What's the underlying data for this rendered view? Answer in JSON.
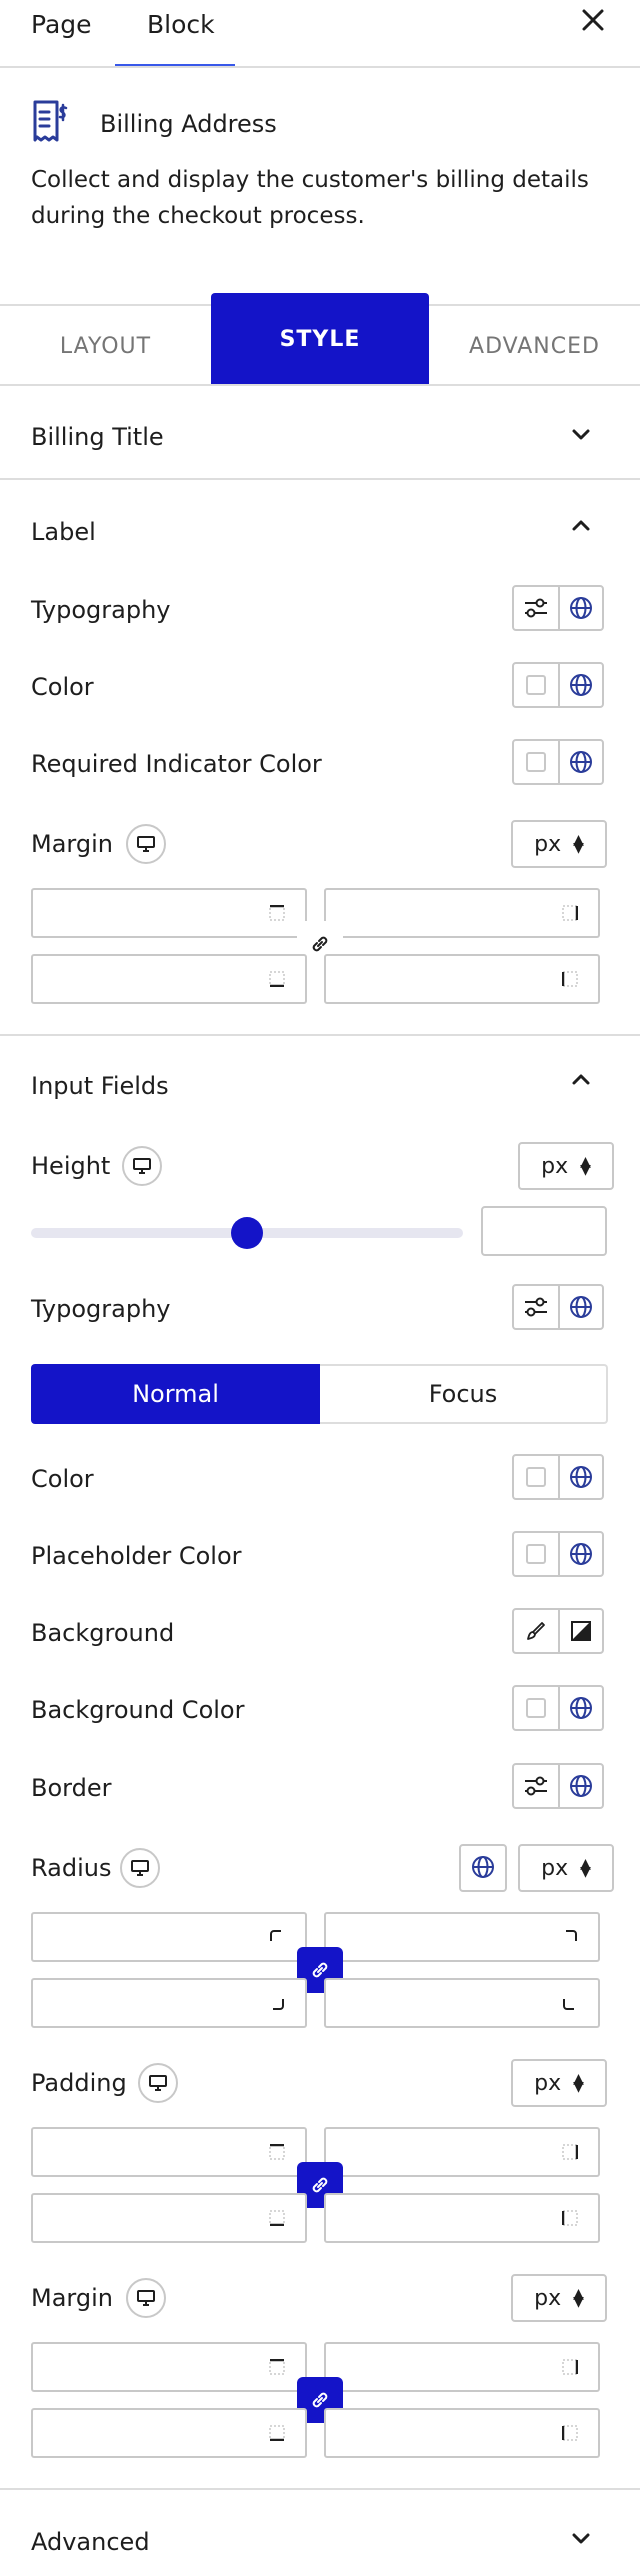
{
  "header": {
    "tabs": [
      {
        "label": "Page"
      },
      {
        "label": "Block"
      }
    ],
    "active_tab": "Block"
  },
  "block": {
    "icon": "billing-document-icon",
    "title": "Billing Address",
    "description": "Collect and display the customer's billing details during the checkout process."
  },
  "panel_tabs": [
    {
      "label": "LAYOUT"
    },
    {
      "label": "STYLE"
    },
    {
      "label": "ADVANCED"
    }
  ],
  "active_panel_tab": "STYLE",
  "sections": {
    "billing_title": {
      "title": "Billing Title",
      "state": "collapsed"
    },
    "label": {
      "title": "Label",
      "state": "expanded",
      "typography": "Typography",
      "color": "Color",
      "required_indicator_color": "Required Indicator Color",
      "margin": "Margin",
      "margin_unit": "px"
    },
    "input_fields": {
      "title": "Input Fields",
      "state": "expanded",
      "height": "Height",
      "height_unit": "px",
      "height_slider_value": 0.5,
      "typography": "Typography",
      "states": [
        "Normal",
        "Focus"
      ],
      "active_state": "Normal",
      "color": "Color",
      "placeholder_color": "Placeholder Color",
      "background": "Background",
      "background_color": "Background Color",
      "border": "Border",
      "radius": "Radius",
      "radius_unit": "px",
      "padding": "Padding",
      "padding_unit": "px",
      "margin": "Margin",
      "margin_unit": "px"
    },
    "advanced": {
      "title": "Advanced",
      "state": "collapsed"
    }
  },
  "colors": {
    "accent": "#1414c8",
    "tab_underline": "#3858e9",
    "icon_blue": "#2a3c9a",
    "border": "#c8c8c8",
    "muted_text": "#757575"
  }
}
